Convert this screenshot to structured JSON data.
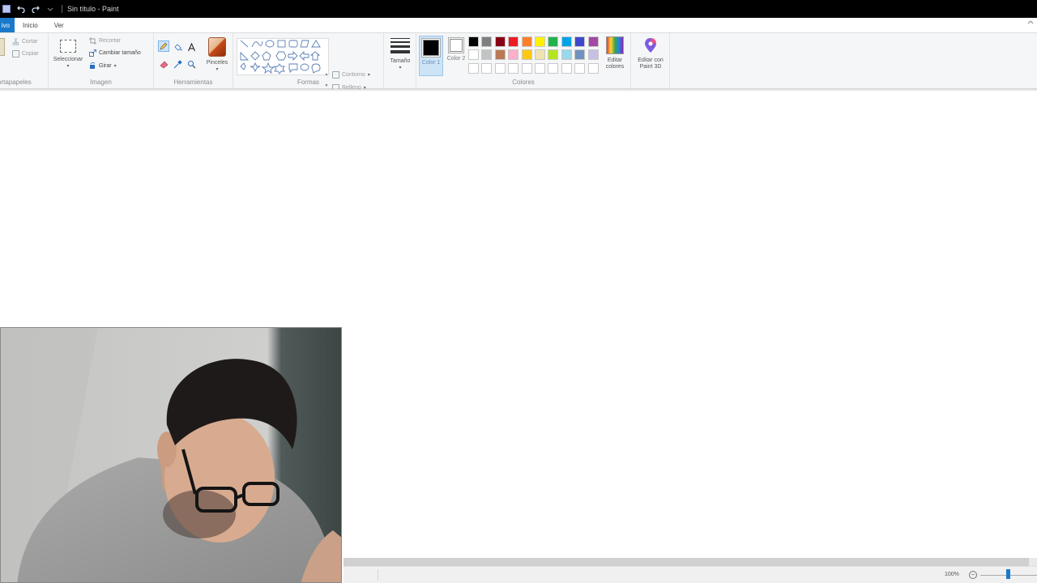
{
  "window": {
    "title": "Sin título - Paint"
  },
  "tabs": [
    {
      "label": "ivo"
    },
    {
      "label": "Inicio"
    },
    {
      "label": "Ver"
    }
  ],
  "ribbon": {
    "clipboard": {
      "label": "ortapapeles",
      "cut": "Cortar",
      "copy": "Copiar"
    },
    "image": {
      "label": "Imagen",
      "select": "Seleccionar",
      "crop": "Recortar",
      "resize": "Cambiar tamaño",
      "rotate": "Girar"
    },
    "tools": {
      "label": "Herramientas",
      "brushes": "Pinceles"
    },
    "shapes": {
      "label": "Formas",
      "outline": "Contorno",
      "fill": "Relleno"
    },
    "size": {
      "label": "Tamaño"
    },
    "colors": {
      "label": "Colores",
      "color1": "Color 1",
      "color2": "Color 2",
      "edit_colors": "Editar colores",
      "paint3d": "Editar con Paint 3D",
      "color1_value": "#000000",
      "color2_value": "#ffffff",
      "palette_row1": [
        "#000000",
        "#7f7f7f",
        "#880015",
        "#ed1c24",
        "#ff7f27",
        "#fff200",
        "#22b14c",
        "#00a2e8",
        "#3f48cc",
        "#a349a4"
      ],
      "palette_row2": [
        "#ffffff",
        "#c3c3c3",
        "#b97a57",
        "#ffaec9",
        "#ffc90e",
        "#efe4b0",
        "#b5e61d",
        "#99d9ea",
        "#7092be",
        "#c8bfe7"
      ]
    }
  },
  "status": {
    "zoom": "100%"
  }
}
